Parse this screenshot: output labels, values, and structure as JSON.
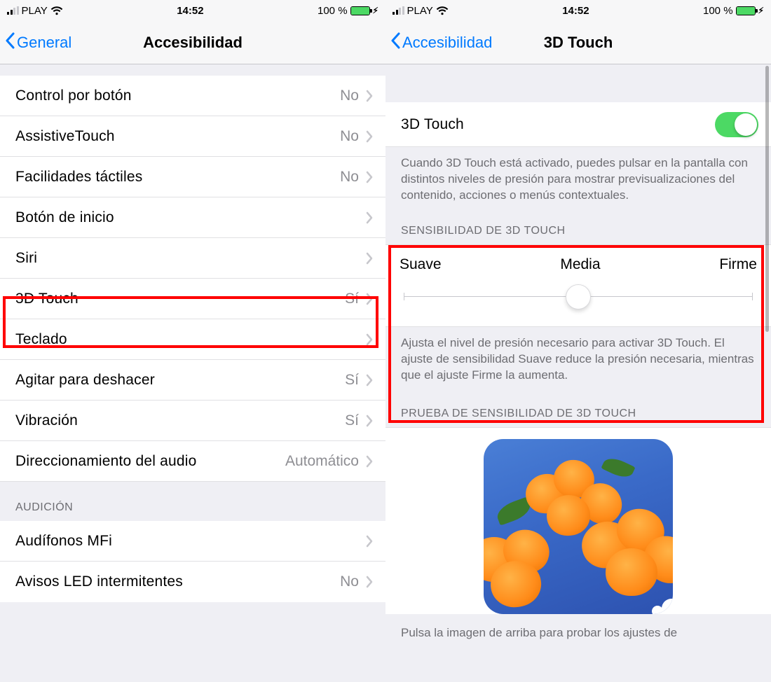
{
  "status": {
    "carrier": "PLAY",
    "time": "14:52",
    "battery_pct": "100 %"
  },
  "left": {
    "back_label": "General",
    "title": "Accesibilidad",
    "rows": [
      {
        "label": "Control por botón",
        "value": "No"
      },
      {
        "label": "AssistiveTouch",
        "value": "No"
      },
      {
        "label": "Facilidades táctiles",
        "value": "No"
      },
      {
        "label": "Botón de inicio",
        "value": ""
      },
      {
        "label": "Siri",
        "value": ""
      },
      {
        "label": "3D Touch",
        "value": "Sí"
      },
      {
        "label": "Teclado",
        "value": ""
      },
      {
        "label": "Agitar para deshacer",
        "value": "Sí"
      },
      {
        "label": "Vibración",
        "value": "Sí"
      },
      {
        "label": "Direccionamiento del audio",
        "value": "Automático"
      }
    ],
    "section2_header": "AUDICIÓN",
    "rows2": [
      {
        "label": "Audífonos MFi",
        "value": ""
      },
      {
        "label": "Avisos LED intermitentes",
        "value": "No"
      }
    ]
  },
  "right": {
    "back_label": "Accesibilidad",
    "title": "3D Touch",
    "toggle_label": "3D Touch",
    "toggle_on": true,
    "toggle_note": "Cuando 3D Touch está activado, puedes pulsar en la pantalla con distintos niveles de presión para mostrar previsualizaciones del contenido, acciones o menús contextuales.",
    "sensitivity_header": "SENSIBILIDAD DE 3D TOUCH",
    "slider": {
      "left": "Suave",
      "mid": "Media",
      "right": "Firme"
    },
    "sensitivity_note": "Ajusta el nivel de presión necesario para activar 3D Touch. El ajuste de sensibilidad Suave reduce la presión necesaria, mientras que el ajuste Firme la aumenta.",
    "test_header": "PRUEBA DE SENSIBILIDAD DE 3D TOUCH",
    "test_note": "Pulsa la imagen de arriba para probar los ajustes de"
  }
}
